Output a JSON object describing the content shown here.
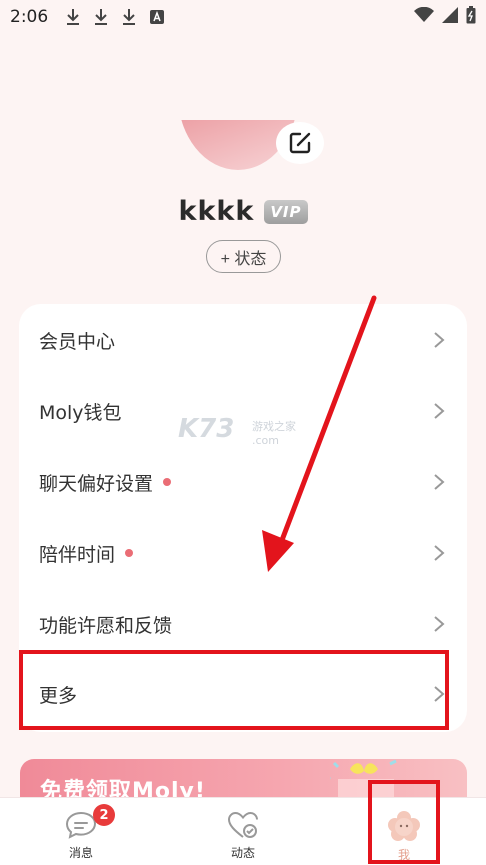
{
  "status_bar": {
    "time": "2:06"
  },
  "profile": {
    "username": "kkkk",
    "vip_label": "VIP",
    "status_button": "+ 状态"
  },
  "menu": {
    "items": [
      {
        "label": "会员中心",
        "dot": false
      },
      {
        "label": "Moly钱包",
        "dot": false
      },
      {
        "label": "聊天偏好设置",
        "dot": true
      },
      {
        "label": "陪伴时间",
        "dot": true
      },
      {
        "label": "功能许愿和反馈",
        "dot": false
      },
      {
        "label": "更多",
        "dot": false
      }
    ]
  },
  "watermark": {
    "main": "K73",
    "sub": "游戏之家",
    "sub2": ".com"
  },
  "banner": {
    "text": "免费领取Moly!"
  },
  "bottom_nav": {
    "items": [
      {
        "label": "消息",
        "badge": "2"
      },
      {
        "label": "动态"
      },
      {
        "label": "我"
      }
    ]
  },
  "colors": {
    "accent_red": "#e3141c",
    "dot_pink": "#ea6d75",
    "background": "#fdf4f3"
  }
}
